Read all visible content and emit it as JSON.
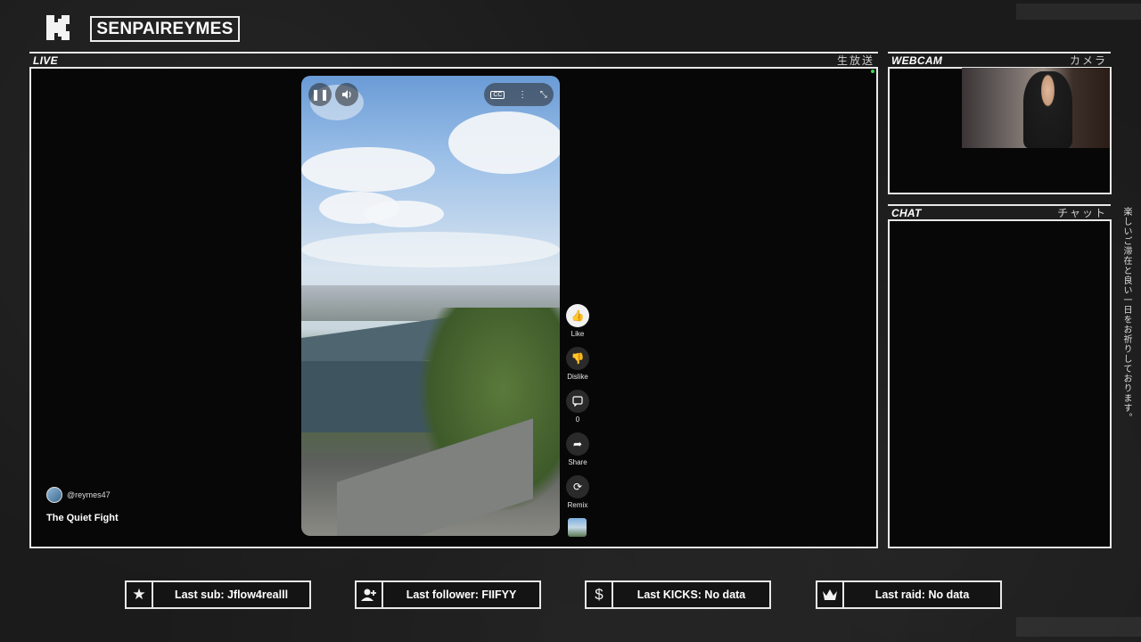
{
  "header": {
    "logo_letter": "K",
    "channel_name": "SENPAIREYMES"
  },
  "live_panel": {
    "title": "LIVE",
    "jp_title": "生放送"
  },
  "webcam_panel": {
    "title": "WEBCAM",
    "jp_title": "カメラ"
  },
  "chat_panel": {
    "title": "CHAT",
    "jp_title": "チャット"
  },
  "video": {
    "creator_handle": "@reymes47",
    "title": "The Quiet Fight",
    "controls": {
      "pause_icon": "pause-icon",
      "volume_icon": "volume-icon",
      "captions_label": "CC",
      "more_icon": "more-vertical-icon",
      "collapse_icon": "collapse-icon"
    },
    "actions": [
      {
        "icon": "thumbs-up-icon",
        "label": "Like"
      },
      {
        "icon": "thumbs-down-icon",
        "label": "Dislike"
      },
      {
        "icon": "comment-icon",
        "label": "0"
      },
      {
        "icon": "share-icon",
        "label": "Share"
      },
      {
        "icon": "remix-icon",
        "label": "Remix"
      }
    ]
  },
  "vertical_message": "楽しいご滞在と良い一日をお祈りしております。",
  "stats": [
    {
      "icon": "star-icon",
      "label": "Last sub: Jflow4realll"
    },
    {
      "icon": "add-user-icon",
      "label": "Last follower: FIIFYY"
    },
    {
      "icon": "dollar-icon",
      "label": "Last KICKS: No data"
    },
    {
      "icon": "crown-icon",
      "label": "Last raid: No data"
    }
  ],
  "colors": {
    "background": "#1b1b1b",
    "border": "#e8e8e8",
    "panel": "#070707",
    "live_dot": "#3bd84a"
  }
}
